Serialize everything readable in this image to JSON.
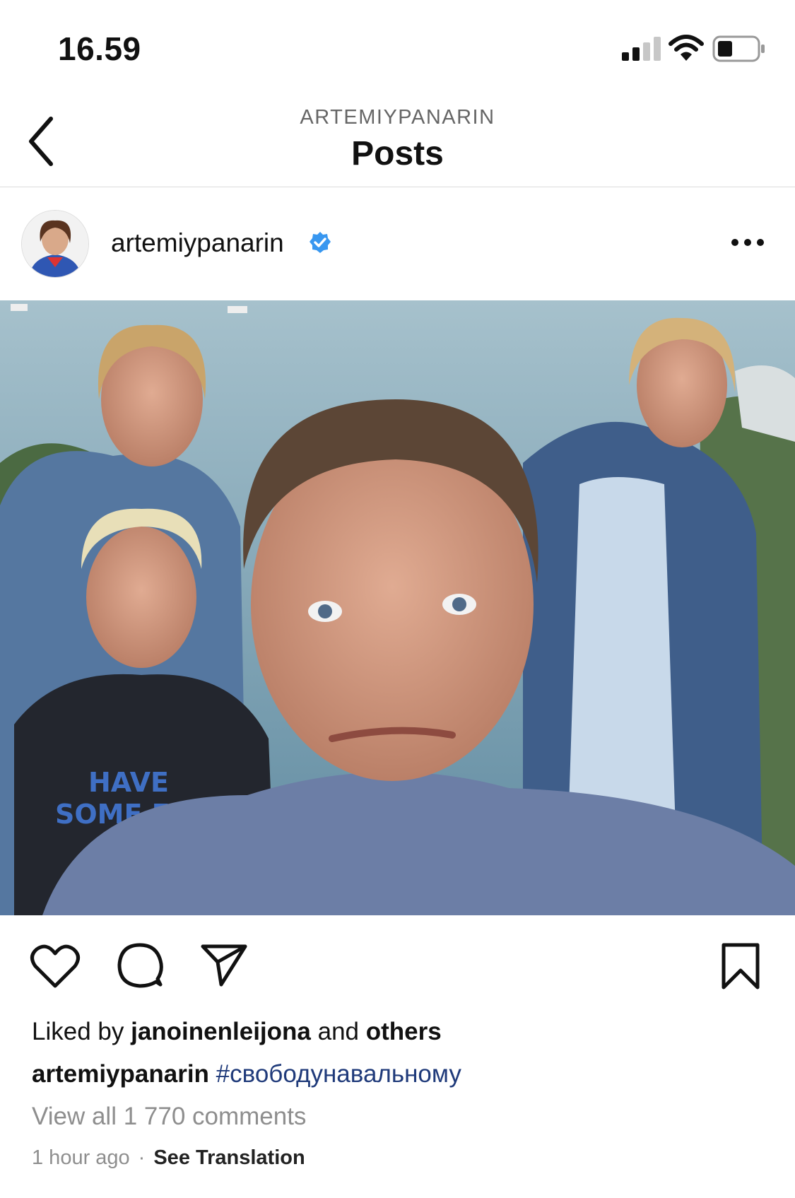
{
  "status_bar": {
    "time": "16.59",
    "icons": [
      "signal-icon",
      "wifi-icon",
      "battery-icon"
    ]
  },
  "header": {
    "username": "ARTEMIYPANARIN",
    "title": "Posts",
    "back_icon": "chevron-left-icon"
  },
  "post": {
    "username": "artemiypanarin",
    "verified": true,
    "more_icon": "more-horizontal-icon",
    "photo_description_icon": "photo",
    "photo_text": "HAVE SOME FUN",
    "actions": {
      "like_icon": "heart-icon",
      "comment_icon": "comment-icon",
      "share_icon": "send-icon",
      "save_icon": "bookmark-icon"
    },
    "likes": {
      "prefix": "Liked by",
      "user": "janoinenleijona",
      "middle": "and",
      "others": "others"
    },
    "caption": {
      "user": "artemiypanarin",
      "hashtag": "#свободунавальному"
    },
    "view_comments": "View all 1 770 comments",
    "time_ago": "1 hour ago",
    "dot": "·",
    "see_translation": "See Translation"
  },
  "colors": {
    "verified": "#3897f0",
    "hashtag": "#1f3a7a",
    "muted": "#8e8e8e"
  }
}
